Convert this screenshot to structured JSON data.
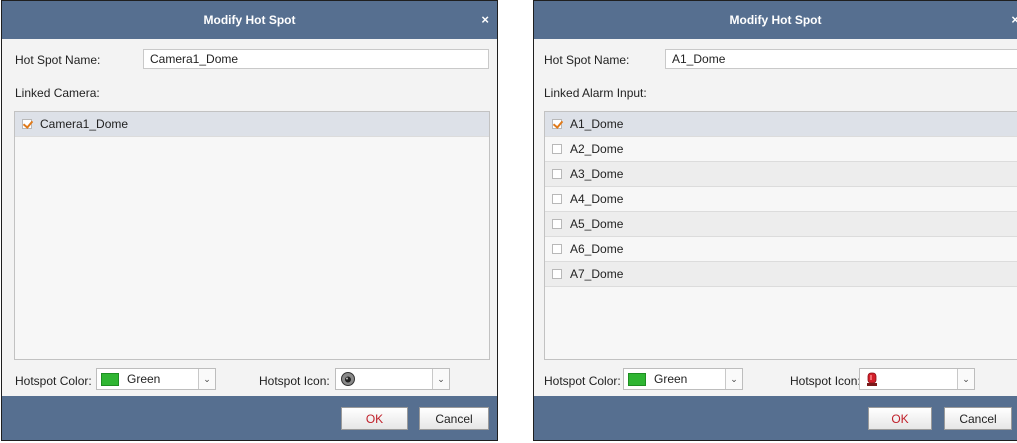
{
  "left": {
    "title": "Modify Hot Spot",
    "close_glyph": "×",
    "name_label": "Hot Spot Name:",
    "name_value": "Camera1_Dome",
    "list_label": "Linked Camera:",
    "items": [
      {
        "label": "Camera1_Dome",
        "checked": true
      }
    ],
    "color_label": "Hotspot Color:",
    "color_value": "Green",
    "icon_label": "Hotspot Icon:",
    "icon_name": "dome-camera-icon",
    "ok_label": "OK",
    "cancel_label": "Cancel"
  },
  "right": {
    "title": "Modify Hot Spot",
    "close_glyph": "×",
    "name_label": "Hot Spot Name:",
    "name_value": "A1_Dome",
    "list_label": "Linked Alarm Input:",
    "items": [
      {
        "label": "A1_Dome",
        "checked": true
      },
      {
        "label": "A2_Dome",
        "checked": false
      },
      {
        "label": "A3_Dome",
        "checked": false
      },
      {
        "label": "A4_Dome",
        "checked": false
      },
      {
        "label": "A5_Dome",
        "checked": false
      },
      {
        "label": "A6_Dome",
        "checked": false
      },
      {
        "label": "A7_Dome",
        "checked": false
      }
    ],
    "color_label": "Hotspot Color:",
    "color_value": "Green",
    "icon_label": "Hotspot Icon:",
    "icon_name": "alarm-siren-icon",
    "ok_label": "OK",
    "cancel_label": "Cancel"
  },
  "colors": {
    "titlebar": "#566f90",
    "hotspot_green": "#2fb532",
    "check": "#e07a1a",
    "ok_text": "#c0202a",
    "alarm_red": "#d21f2a"
  }
}
